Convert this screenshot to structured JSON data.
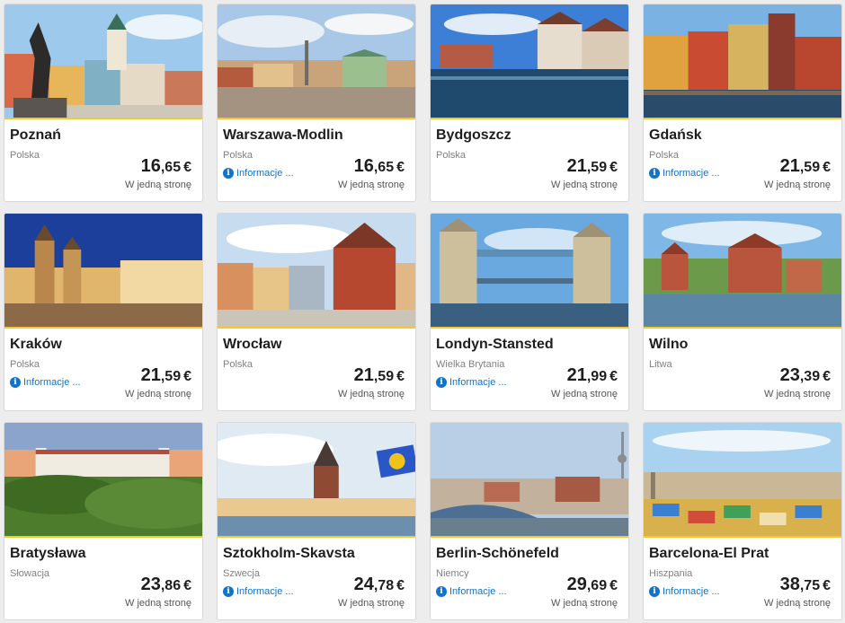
{
  "info_label": "Informacje ...",
  "oneway_label": "W jedną stronę",
  "currency": "€",
  "accent": "#f1c933",
  "info_color": "#1173c9",
  "destinations": [
    {
      "city": "Poznań",
      "country": "Polska",
      "price_int": "16",
      "price_dec": ",65",
      "info": false
    },
    {
      "city": "Warszawa-Modlin",
      "country": "Polska",
      "price_int": "16",
      "price_dec": ",65",
      "info": true
    },
    {
      "city": "Bydgoszcz",
      "country": "Polska",
      "price_int": "21",
      "price_dec": ",59",
      "info": false
    },
    {
      "city": "Gdańsk",
      "country": "Polska",
      "price_int": "21",
      "price_dec": ",59",
      "info": true
    },
    {
      "city": "Kraków",
      "country": "Polska",
      "price_int": "21",
      "price_dec": ",59",
      "info": true
    },
    {
      "city": "Wrocław",
      "country": "Polska",
      "price_int": "21",
      "price_dec": ",59",
      "info": false
    },
    {
      "city": "Londyn-Stansted",
      "country": "Wielka Brytania",
      "price_int": "21",
      "price_dec": ",99",
      "info": true
    },
    {
      "city": "Wilno",
      "country": "Litwa",
      "price_int": "23",
      "price_dec": ",39",
      "info": false
    },
    {
      "city": "Bratysława",
      "country": "Słowacja",
      "price_int": "23",
      "price_dec": ",86",
      "info": false
    },
    {
      "city": "Sztokholm-Skavsta",
      "country": "Szwecja",
      "price_int": "24",
      "price_dec": ",78",
      "info": true
    },
    {
      "city": "Berlin-Schönefeld",
      "country": "Niemcy",
      "price_int": "29",
      "price_dec": ",69",
      "info": true
    },
    {
      "city": "Barcelona-El Prat",
      "country": "Hiszpania",
      "price_int": "38",
      "price_dec": ",75",
      "info": true
    }
  ]
}
